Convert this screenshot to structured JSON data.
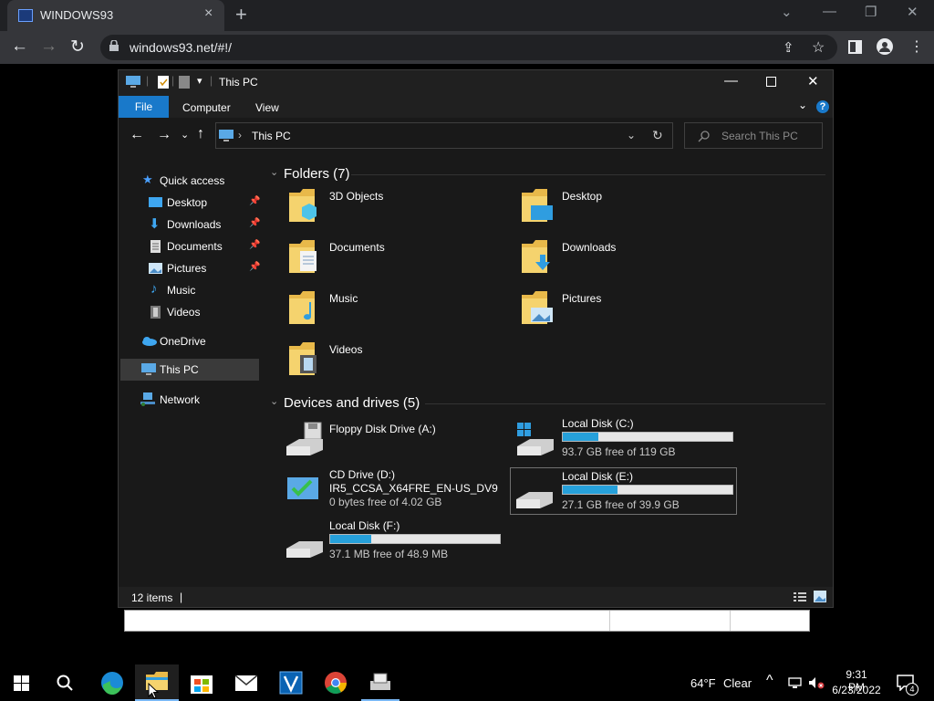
{
  "browser": {
    "tab_title": "WINDOWS93",
    "tab_close": "×",
    "new_tab": "+",
    "url": "windows93.net/#!/",
    "win_min": "—",
    "win_restore": "❐",
    "win_close": "✕",
    "chevron": "⌄"
  },
  "explorer": {
    "title": "This PC",
    "ribbon": {
      "file": "File",
      "computer": "Computer",
      "view": "View",
      "help": "?"
    },
    "address": "This PC",
    "search_placeholder": "Search This PC",
    "nav": [
      {
        "label": "Quick access"
      },
      {
        "label": "Desktop"
      },
      {
        "label": "Downloads"
      },
      {
        "label": "Documents"
      },
      {
        "label": "Pictures"
      },
      {
        "label": "Music"
      },
      {
        "label": "Videos"
      },
      {
        "label": "OneDrive"
      },
      {
        "label": "This PC"
      },
      {
        "label": "Network"
      }
    ],
    "folders_title": "Folders (7)",
    "folders": [
      {
        "name": "3D Objects"
      },
      {
        "name": "Desktop"
      },
      {
        "name": "Documents"
      },
      {
        "name": "Downloads"
      },
      {
        "name": "Music"
      },
      {
        "name": "Pictures"
      },
      {
        "name": "Videos"
      }
    ],
    "drives_title": "Devices and drives (5)",
    "drives": [
      {
        "name": "Floppy Disk Drive (A:)"
      },
      {
        "name": "Local Disk (C:)",
        "free": "93.7 GB free of 119 GB",
        "used_fraction": 0.21
      },
      {
        "name": "CD Drive (D:)",
        "label": "IR5_CCSA_X64FRE_EN-US_DV9",
        "free": "0 bytes free of 4.02 GB"
      },
      {
        "name": "Local Disk (E:)",
        "free": "27.1 GB free of 39.9 GB",
        "used_fraction": 0.32
      },
      {
        "name": "Local Disk (F:)",
        "free": "37.1 MB free of 48.9 MB",
        "used_fraction": 0.24
      }
    ],
    "status": "12 items"
  },
  "taskbar": {
    "weather": "64°F",
    "weather_text": "Clear",
    "time": "9:31 PM",
    "date": "6/23/2022",
    "notif_count": "4"
  },
  "colors": {
    "accent": "#1979ca",
    "bar_fill": "#26a0da"
  }
}
